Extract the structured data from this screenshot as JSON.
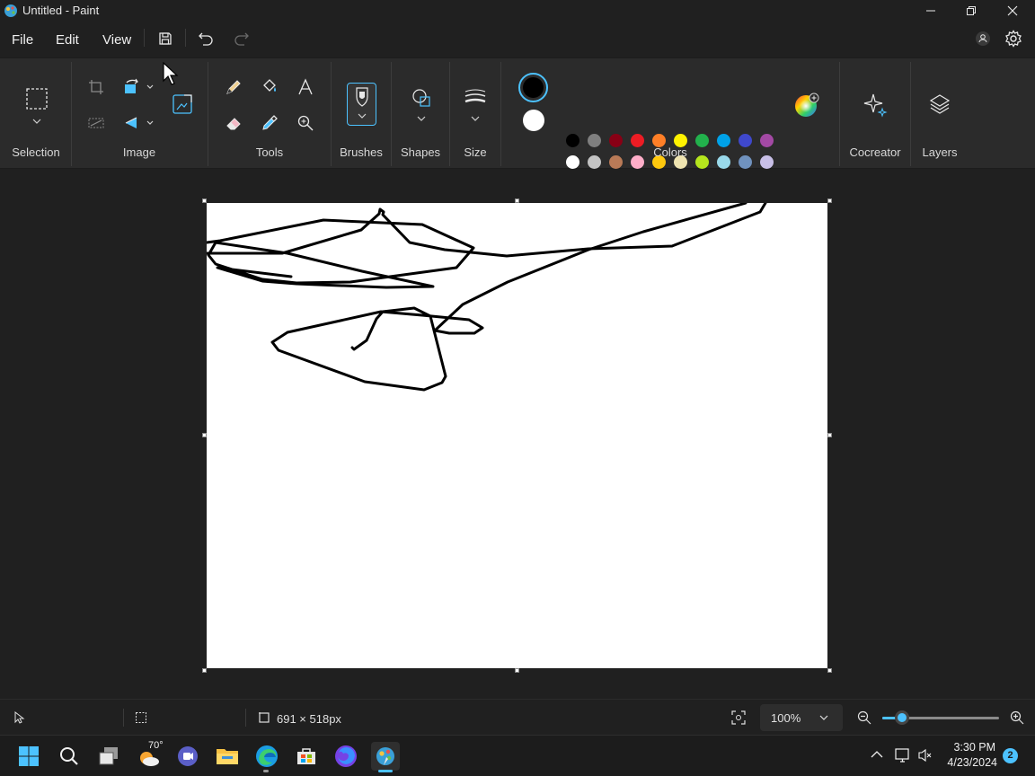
{
  "window": {
    "title": "Untitled - Paint"
  },
  "menu": {
    "file": "File",
    "edit": "Edit",
    "view": "View"
  },
  "ribbon": {
    "groups": {
      "selection": "Selection",
      "image": "Image",
      "tools": "Tools",
      "brushes": "Brushes",
      "shapes": "Shapes",
      "size": "Size",
      "colors": "Colors",
      "cocreator": "Cocreator",
      "layers": "Layers"
    },
    "primary_color": "#000000",
    "secondary_color": "#ffffff",
    "palette_row1": [
      "#000000",
      "#7f7f7f",
      "#880015",
      "#ed1c24",
      "#ff7f27",
      "#fff200",
      "#22b14c",
      "#00a2e8",
      "#3f48cc",
      "#a349a4"
    ],
    "palette_row2": [
      "#ffffff",
      "#c3c3c3",
      "#b97a57",
      "#ffaec9",
      "#ffc90e",
      "#efe4b0",
      "#b5e61d",
      "#99d9ea",
      "#7092be",
      "#c8bfe7"
    ],
    "accent": "#4cc2ff"
  },
  "status": {
    "canvas_size": "691 × 518px",
    "zoom": "100%"
  },
  "taskbar": {
    "weather_temp": "70°",
    "time": "3:30 PM",
    "date": "4/23/2024",
    "notification_count": "2"
  }
}
